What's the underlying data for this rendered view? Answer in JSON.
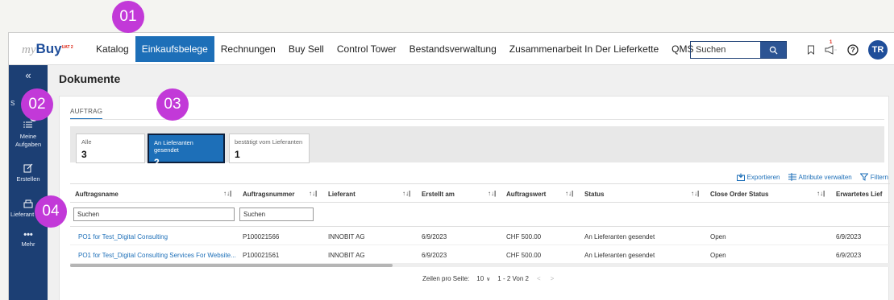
{
  "logo": {
    "text": "my",
    "brand": "Buy",
    "badge": "UAT 2"
  },
  "nav": [
    "Katalog",
    "Einkaufsbelege",
    "Rechnungen",
    "Buy Sell",
    "Control Tower",
    "Bestandsverwaltung",
    "Zusammenarbeit In Der Lieferkette",
    "QMS"
  ],
  "search": {
    "placeholder": "Suchen"
  },
  "notifications": {
    "count": "1"
  },
  "user": {
    "initials": "TR"
  },
  "sidebar": {
    "collapse": "«",
    "badge": "5",
    "items": [
      "Meine Aufgaben",
      "Erstellen",
      "Lieferant",
      "Mehr"
    ],
    "partial_label": "S"
  },
  "page": {
    "title": "Dokumente"
  },
  "tab": {
    "label": "AUFTRAG"
  },
  "tiles": [
    {
      "label": "Alle",
      "count": "3"
    },
    {
      "label": "An Lieferanten gesendet",
      "count": "2"
    },
    {
      "label": "bestätigt vom Lieferanten",
      "count": "1"
    }
  ],
  "toolbar": {
    "export": "Exportieren",
    "attributes": "Attribute verwalten",
    "filter": "Filtern"
  },
  "columns": [
    "Auftragsname",
    "Auftragsnummer",
    "Lieferant",
    "Erstellt am",
    "Auftragswert",
    "Status",
    "Close Order Status",
    "Erwartetes Lief"
  ],
  "filters": {
    "name": "Suchen",
    "number": "Suchen"
  },
  "rows": [
    {
      "name": "PO1 for Test_Digital Consulting",
      "number": "P100021566",
      "supplier": "INNOBIT AG",
      "date": "6/9/2023",
      "value": "CHF 500.00",
      "status": "An Lieferanten gesendet",
      "close": "Open",
      "expected": "6/9/2023"
    },
    {
      "name": "PO1 for Test_Digital Consulting Services For Website...",
      "number": "P100021561",
      "supplier": "INNOBIT AG",
      "date": "6/9/2023",
      "value": "CHF 500.00",
      "status": "An Lieferanten gesendet",
      "close": "Open",
      "expected": "6/9/2023"
    }
  ],
  "pager": {
    "label": "Zeilen pro Seite:",
    "size": "10",
    "range": "1 - 2 Von 2"
  },
  "markers": [
    "01",
    "02",
    "03",
    "04"
  ],
  "colors": {
    "primary": "#1d6fb8",
    "sidebar": "#1c3f74",
    "marker": "#c239d8"
  }
}
